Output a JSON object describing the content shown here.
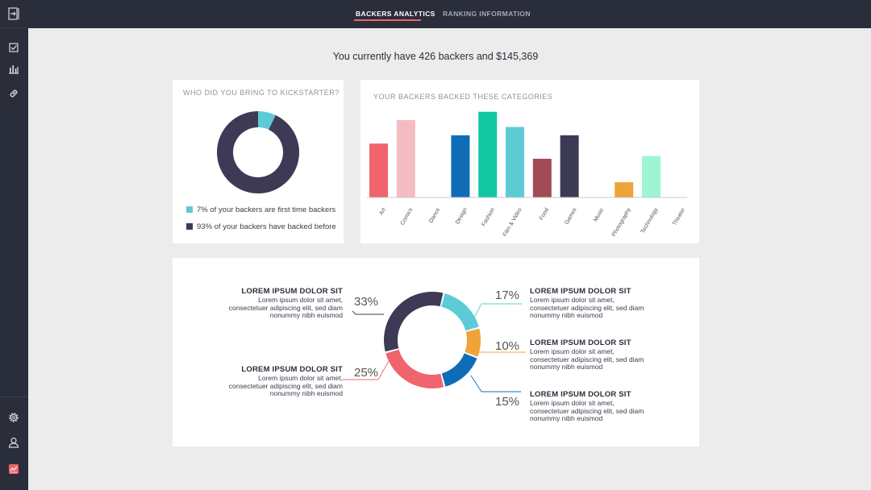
{
  "nav": {
    "tabs": [
      {
        "label": "BACKERS ANALYTICS",
        "active": true
      },
      {
        "label": "RANKING INFORMATION",
        "active": false
      }
    ]
  },
  "sidebar": {
    "top_icon": "collapse-sidebar-icon",
    "items": [
      "checklist-icon",
      "bar-chart-icon",
      "link-icon"
    ],
    "bottom_items": [
      "settings-icon",
      "user-icon",
      "stats-card-icon"
    ]
  },
  "headline": "You currently have 426 backers and $145,369",
  "donut_card": {
    "title": "WHO DID YOU BRING TO KICKSTARTER?",
    "legend": [
      {
        "text": "7% of your backers are first time backers",
        "color": "#5ccbd6"
      },
      {
        "text": "93% of your backers have backed before",
        "color": "#3d3a56"
      }
    ]
  },
  "bar_card": {
    "title": "YOUR BACKERS BACKED THESE CATEGORIES"
  },
  "breakdown_card": {
    "annotations": [
      {
        "title": "LOREM IPSUM DOLOR SIT",
        "body": "Lorem ipsum dolor sit amet,\nconsectetuer adipiscing elit, sed diam\nnonummy nibh euismod",
        "pct": "33%"
      },
      {
        "title": "LOREM IPSUM DOLOR SIT",
        "body": "Lorem ipsum dolor sit amet,\nconsectetuer adipiscing elit, sed diam\nnonummy nibh euismod",
        "pct": "25%"
      },
      {
        "title": "LOREM IPSUM DOLOR SIT",
        "body": "Lorem ipsum dolor sit amet,\nconsectetuer adipiscing elit, sed diam\nnonummy nibh euismod",
        "pct": "17%"
      },
      {
        "title": "LOREM IPSUM DOLOR SIT",
        "body": "Lorem ipsum dolor sit amet,\nconsectetuer adipiscing elit, sed diam\nnonummy nibh euismod",
        "pct": "10%"
      },
      {
        "title": "LOREM IPSUM DOLOR SIT",
        "body": "Lorem ipsum dolor sit amet,\nconsectetuer adipiscing elit, sed diam\nnonummy nibh euismod",
        "pct": "15%"
      }
    ]
  },
  "chart_data": [
    {
      "type": "pie",
      "title": "WHO DID YOU BRING TO KICKSTARTER?",
      "categories": [
        "first time backers",
        "backed before"
      ],
      "values": [
        7,
        93
      ],
      "colors": [
        "#5ccbd6",
        "#3d3a56"
      ]
    },
    {
      "type": "bar",
      "title": "YOUR BACKERS BACKED THESE CATEGORIES",
      "categories": [
        "Art",
        "Comics",
        "Dance",
        "Design",
        "Fashion",
        "Film & Video",
        "Food",
        "Games",
        "Music",
        "Photography",
        "Technology",
        "Theater"
      ],
      "values": [
        39,
        56,
        0,
        45,
        62,
        51,
        28,
        45,
        0,
        11,
        30,
        0
      ],
      "colors": [
        "#f0646e",
        "#f4bcc1",
        "#cccccc",
        "#0f6db8",
        "#12c8a0",
        "#5ccbd6",
        "#a04b55",
        "#3d3a56",
        "#cccccc",
        "#f0a33a",
        "#9df5d1",
        "#cccccc"
      ],
      "ylim": [
        0,
        70
      ],
      "grid": false
    },
    {
      "type": "pie",
      "categories": [
        "33%",
        "25%",
        "17%",
        "10%",
        "15%"
      ],
      "values": [
        33,
        25,
        17,
        10,
        15
      ],
      "colors": [
        "#3d3a56",
        "#f0646e",
        "#5ccbd6",
        "#f0a33a",
        "#0f6db8"
      ]
    }
  ]
}
